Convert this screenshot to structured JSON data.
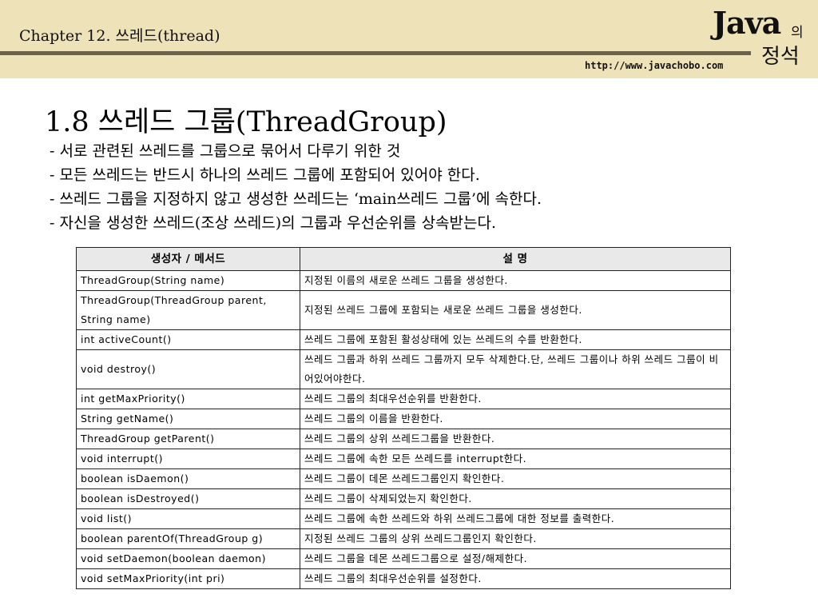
{
  "header": {
    "chapter": "Chapter 12. 쓰레드(thread)",
    "url": "http://www.javachobo.com",
    "logo": {
      "java": "Java",
      "ui": "의",
      "sub": "정석"
    }
  },
  "slide": {
    "title": "1.8 쓰레드 그룹(ThreadGroup)",
    "bullets": [
      "- 서로 관련된 쓰레드를 그룹으로 묶어서 다루기 위한 것",
      "- 모든 쓰레드는 반드시 하나의 쓰레드 그룹에 포함되어 있어야 한다.",
      "- 쓰레드 그룹을 지정하지 않고 생성한 쓰레드는 ‘main쓰레드 그룹’에 속한다.",
      "- 자신을 생성한 쓰레드(조상 쓰레드)의 그룹과 우선순위를 상속받는다."
    ]
  },
  "table": {
    "headers": [
      "생성자 / 메서드",
      "설 명"
    ],
    "rows": [
      {
        "method": "ThreadGroup(String name)",
        "desc": "지정된 이름의 새로운 쓰레드 그룹을 생성한다."
      },
      {
        "method": "ThreadGroup(ThreadGroup parent, String name)",
        "desc": "지정된 쓰레드 그룹에 포함되는 새로운 쓰레드 그룹을 생성한다."
      },
      {
        "method": "int activeCount()",
        "desc": "쓰레드 그룹에 포함된 활성상태에 있는 쓰레드의 수를 반환한다."
      },
      {
        "method": "void destroy()",
        "desc": "쓰레드 그룹과 하위 쓰레드 그룹까지 모두 삭제한다.단, 쓰레드 그룹이나 하위 쓰레드 그룹이 비어있어야한다."
      },
      {
        "method": "int getMaxPriority()",
        "desc": "쓰레드 그룹의 최대우선순위를 반환한다."
      },
      {
        "method": "String getName()",
        "desc": "쓰레드 그룹의 이름을 반환한다."
      },
      {
        "method": "ThreadGroup getParent()",
        "desc": "쓰레드 그룹의 상위 쓰레드그룹을 반환한다."
      },
      {
        "method": "void interrupt()",
        "desc": "쓰레드 그룹에 속한 모든 쓰레드를 interrupt한다."
      },
      {
        "method": "boolean isDaemon()",
        "desc": "쓰레드 그룹이 데몬 쓰레드그룹인지 확인한다."
      },
      {
        "method": "boolean isDestroyed()",
        "desc": "쓰레드 그룹이 삭제되었는지 확인한다."
      },
      {
        "method": "void list()",
        "desc": "쓰레드 그룹에 속한 쓰레드와 하위 쓰레드그룹에 대한 정보를 출력한다."
      },
      {
        "method": "boolean parentOf(ThreadGroup g)",
        "desc": "지정된 쓰레드 그룹의 상위 쓰레드그룹인지 확인한다."
      },
      {
        "method": "void setDaemon(boolean daemon)",
        "desc": "쓰레드 그룹을 데몬 쓰레드그룹으로 설정/해제한다."
      },
      {
        "method": "void setMaxPriority(int pri)",
        "desc": "쓰레드 그룹의 최대우선순위를 설정한다."
      }
    ]
  }
}
